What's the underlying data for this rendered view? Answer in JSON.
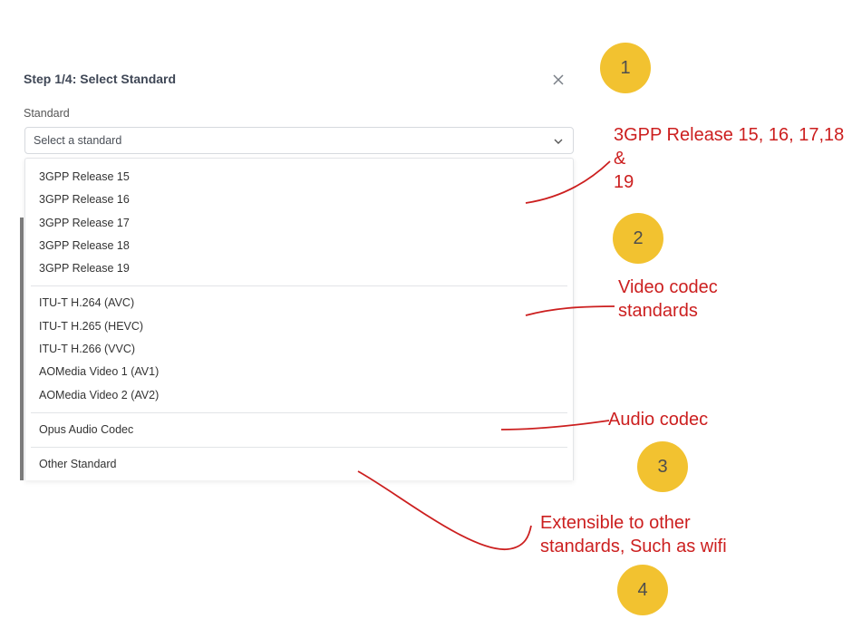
{
  "dialog": {
    "title": "Step 1/4: Select Standard",
    "close_icon": "close-icon",
    "field_label": "Standard",
    "select_placeholder": "Select a standard",
    "chevron_icon": "chevron-down-icon"
  },
  "dropdown": {
    "groups": [
      {
        "options": [
          "3GPP Release 15",
          "3GPP Release 16",
          "3GPP Release 17",
          "3GPP Release 18",
          "3GPP Release 19"
        ]
      },
      {
        "options": [
          "ITU-T H.264 (AVC)",
          "ITU-T H.265 (HEVC)",
          "ITU-T H.266 (VVC)",
          "AOMedia Video 1 (AV1)",
          "AOMedia Video 2 (AV2)"
        ]
      },
      {
        "options": [
          "Opus Audio Codec"
        ]
      },
      {
        "options": [
          "Other Standard"
        ]
      }
    ]
  },
  "annotations": {
    "badges": [
      "1",
      "2",
      "3",
      "4"
    ],
    "notes": [
      [
        "3GPP Release 15, 16, 17,18 &",
        "19"
      ],
      [
        "Video codec",
        "standards"
      ],
      [
        "Audio codec"
      ],
      [
        "Extensible to other",
        "standards, Such as wifi"
      ]
    ]
  },
  "colors": {
    "badge": "#f2c230",
    "annotation_text": "#cc1f1f",
    "title_text": "#3f4756"
  }
}
